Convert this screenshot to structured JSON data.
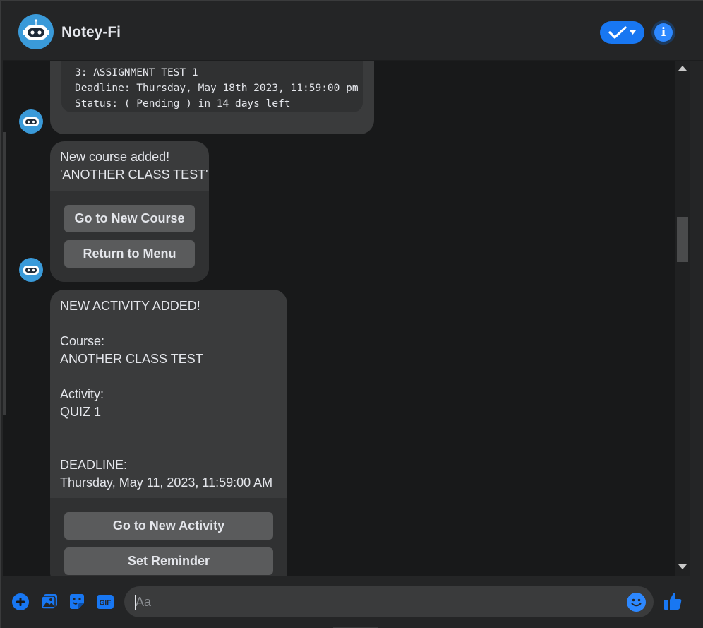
{
  "header": {
    "title": "Notey-Fi"
  },
  "messages": [
    {
      "lines": [
        "3: ASSIGNMENT TEST 1",
        "Deadline: Thursday, May 18th 2023, 11:59:00 pm",
        "Status: ( Pending ) in 14 days left"
      ]
    },
    {
      "lines": [
        "New course added!",
        "'ANOTHER CLASS TEST'"
      ],
      "buttons": [
        "Go to New Course",
        "Return to Menu"
      ]
    },
    {
      "lines": [
        "NEW ACTIVITY ADDED!",
        "",
        "Course:",
        "ANOTHER CLASS TEST",
        "",
        "Activity:",
        "QUIZ 1",
        "",
        "",
        "DEADLINE:",
        "Thursday, May 11, 2023, 11:59:00 AM"
      ],
      "buttons": [
        "Go to New Activity",
        "Set Reminder"
      ]
    }
  ],
  "composer": {
    "placeholder": "Aa"
  },
  "colors": {
    "accent": "#1877f2",
    "bubble": "#3a3b3c",
    "chat_bg": "#18191a",
    "bot_avatar": "#3a9ad9"
  },
  "icons": {
    "header": [
      "robot-avatar-icon",
      "checkmark-icon",
      "chevron-down-icon",
      "info-icon"
    ],
    "footer": [
      "plus-icon",
      "image-icon",
      "sticker-icon",
      "gif-icon",
      "emoji-icon",
      "thumbs-up-icon"
    ]
  }
}
